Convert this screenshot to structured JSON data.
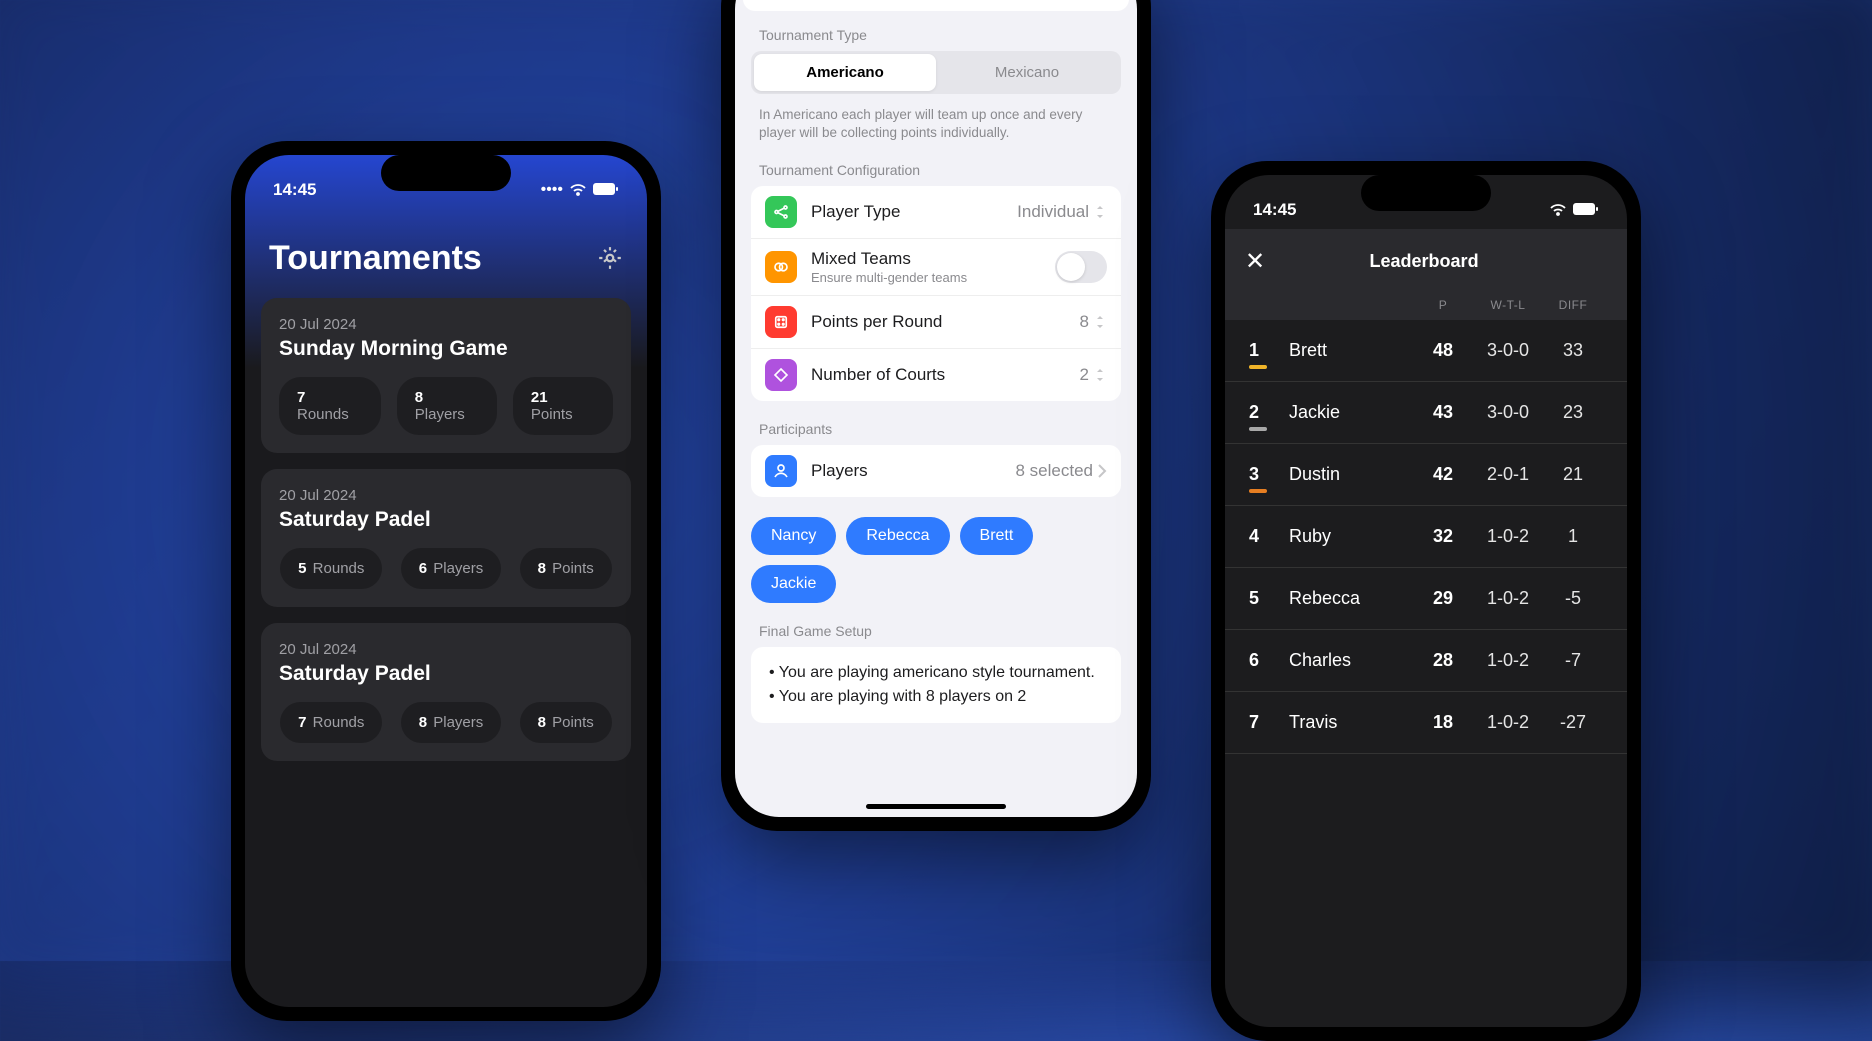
{
  "status": {
    "time": "14:45"
  },
  "screen1": {
    "title": "Tournaments",
    "cards": [
      {
        "date": "20 Jul 2024",
        "name": "Sunday Morning Game",
        "rounds": "7",
        "players": "8",
        "points": "21"
      },
      {
        "date": "20 Jul 2024",
        "name": "Saturday Padel",
        "rounds": "5",
        "players": "6",
        "points": "8"
      },
      {
        "date": "20 Jul 2024",
        "name": "Saturday Padel",
        "rounds": "7",
        "players": "8",
        "points": "8"
      }
    ],
    "labels": {
      "rounds": "Rounds",
      "players": "Players",
      "points": "Points"
    }
  },
  "screen2": {
    "type_label": "Tournament Type",
    "seg": {
      "americano": "Americano",
      "mexicano": "Mexicano"
    },
    "help": "In Americano each player will team up once and every player will be collecting points individually.",
    "config_label": "Tournament Configuration",
    "rows": {
      "player_type": {
        "title": "Player Type",
        "value": "Individual"
      },
      "mixed": {
        "title": "Mixed Teams",
        "sub": "Ensure multi-gender teams"
      },
      "ppr": {
        "title": "Points per Round",
        "value": "8"
      },
      "courts": {
        "title": "Number of Courts",
        "value": "2"
      }
    },
    "participants_label": "Participants",
    "players_row": {
      "title": "Players",
      "value": "8 selected"
    },
    "chips": [
      "Nancy",
      "Rebecca",
      "Brett",
      "Jackie"
    ],
    "final_label": "Final Game Setup",
    "final_lines": [
      "• You are playing americano style tournament.",
      "• You are playing with 8 players on 2"
    ]
  },
  "screen3": {
    "title": "Leaderboard",
    "cols": {
      "p": "P",
      "wtl": "W-T-L",
      "diff": "DIFF"
    },
    "rows": [
      {
        "rank": "1",
        "name": "Brett",
        "p": "48",
        "wtl": "3-0-0",
        "diff": "33",
        "bar": "#f0b429"
      },
      {
        "rank": "2",
        "name": "Jackie",
        "p": "43",
        "wtl": "3-0-0",
        "diff": "23",
        "bar": "#a8a8a8"
      },
      {
        "rank": "3",
        "name": "Dustin",
        "p": "42",
        "wtl": "2-0-1",
        "diff": "21",
        "bar": "#e67e22"
      },
      {
        "rank": "4",
        "name": "Ruby",
        "p": "32",
        "wtl": "1-0-2",
        "diff": "1",
        "bar": null
      },
      {
        "rank": "5",
        "name": "Rebecca",
        "p": "29",
        "wtl": "1-0-2",
        "diff": "-5",
        "bar": null
      },
      {
        "rank": "6",
        "name": "Charles",
        "p": "28",
        "wtl": "1-0-2",
        "diff": "-7",
        "bar": null
      },
      {
        "rank": "7",
        "name": "Travis",
        "p": "18",
        "wtl": "1-0-2",
        "diff": "-27",
        "bar": null
      }
    ]
  }
}
